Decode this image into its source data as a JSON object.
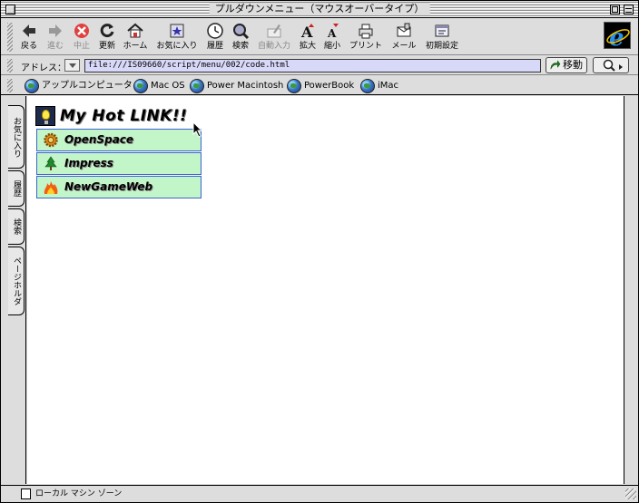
{
  "window": {
    "title": "プルダウンメニュー（マウスオーバータイプ）"
  },
  "toolbar": {
    "buttons": [
      {
        "label": "戻る",
        "icon": "back-arrow-icon",
        "enabled": true
      },
      {
        "label": "進む",
        "icon": "forward-arrow-icon",
        "enabled": false
      },
      {
        "label": "中止",
        "icon": "stop-icon",
        "enabled": false
      },
      {
        "label": "更新",
        "icon": "refresh-icon",
        "enabled": true
      },
      {
        "label": "ホーム",
        "icon": "home-icon",
        "enabled": true
      },
      {
        "label": "お気に入り",
        "icon": "favorites-icon",
        "enabled": true
      },
      {
        "label": "履歴",
        "icon": "history-icon",
        "enabled": true
      },
      {
        "label": "検索",
        "icon": "search-icon",
        "enabled": true
      },
      {
        "label": "自動入力",
        "icon": "autofill-icon",
        "enabled": false
      },
      {
        "label": "拡大",
        "icon": "text-larger-icon",
        "enabled": true
      },
      {
        "label": "縮小",
        "icon": "text-smaller-icon",
        "enabled": true
      },
      {
        "label": "プリント",
        "icon": "print-icon",
        "enabled": true
      },
      {
        "label": "メール",
        "icon": "mail-icon",
        "enabled": true
      },
      {
        "label": "初期設定",
        "icon": "preferences-icon",
        "enabled": true
      }
    ]
  },
  "address": {
    "label": "アドレス：",
    "url": "file:///IS09660/script/menu/002/code.html",
    "go_label": "移動"
  },
  "favorites_bar": {
    "items": [
      {
        "label": "アップルコンピュータ"
      },
      {
        "label": "Mac OS"
      },
      {
        "label": "Power Macintosh"
      },
      {
        "label": "PowerBook"
      },
      {
        "label": "iMac"
      }
    ]
  },
  "side_tabs": [
    {
      "label": "お気に入り"
    },
    {
      "label": "履歴"
    },
    {
      "label": "検索"
    },
    {
      "label": "ページホルダ"
    }
  ],
  "page": {
    "menu_title": "My Hot LINK!!",
    "menu_items": [
      {
        "label": "OpenSpace",
        "icon": "gear-icon"
      },
      {
        "label": "Impress",
        "icon": "tree-icon"
      },
      {
        "label": "NewGameWeb",
        "icon": "flame-icon"
      }
    ]
  },
  "status": {
    "zone": "ローカル マシン ゾーン"
  },
  "colors": {
    "menu_item_bg": "#c2f5c8",
    "menu_item_border": "#3a64d0",
    "address_bg": "#d8d8f8",
    "chrome_bg": "#dddddd"
  }
}
